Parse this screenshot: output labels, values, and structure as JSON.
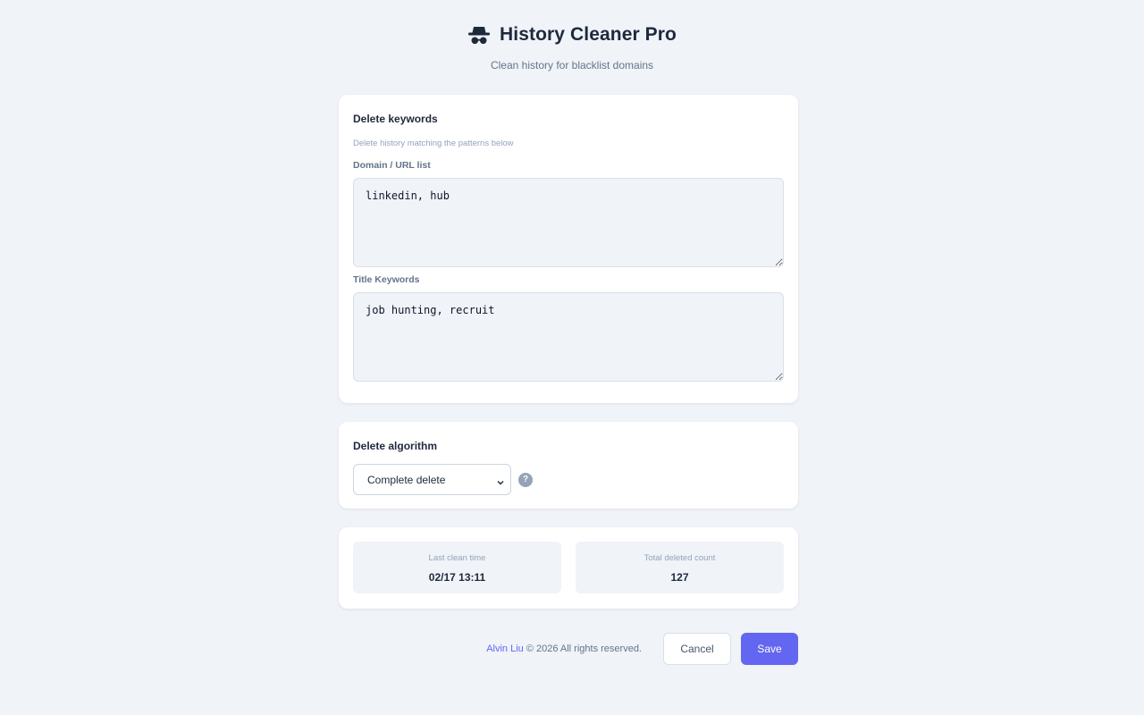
{
  "app": {
    "icon": "incognito-spy-icon",
    "title": "History Cleaner Pro",
    "subtitle": "Clean history for blacklist domains"
  },
  "keywords_section": {
    "title": "Delete keywords",
    "description": "Delete history matching the patterns below",
    "domain_label": "Domain / URL list",
    "domain_value": "linkedin, hub",
    "title_label": "Title Keywords",
    "title_value": "job hunting, recruit"
  },
  "algorithm_section": {
    "title": "Delete algorithm",
    "selected": "Complete delete",
    "help_icon": "help-circle-icon",
    "help_glyph": "?"
  },
  "stats": {
    "last_clean_label": "Last clean time",
    "last_clean_value": "02/17 13:11",
    "total_deleted_label": "Total deleted count",
    "total_deleted_value": "127"
  },
  "footer": {
    "author": "Alvin Liu",
    "copyright_rest": " © 2026 All rights reserved.",
    "cancel_label": "Cancel",
    "save_label": "Save"
  },
  "colors": {
    "background": "#f0f3f8",
    "card": "#ffffff",
    "accent": "#6366f1",
    "muted_text": "#64748b",
    "help_icon": "#94a3b8"
  }
}
